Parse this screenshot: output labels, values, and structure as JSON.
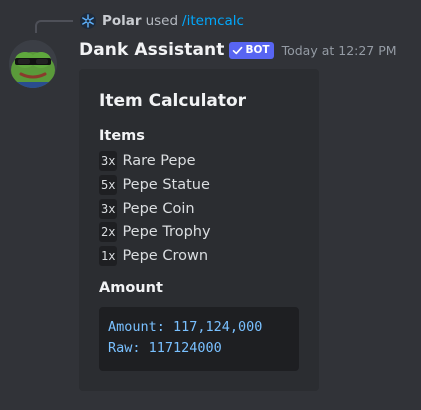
{
  "reply": {
    "username": "Polar",
    "used_text": "used",
    "command": "/itemcalc"
  },
  "message": {
    "username": "Dank Assistant",
    "bot_badge": "BOT",
    "timestamp": "Today at 12:27 PM"
  },
  "embed": {
    "title": "Item Calculator",
    "items_field_name": "Items",
    "items": [
      {
        "qty": "3x",
        "name": "Rare Pepe"
      },
      {
        "qty": "5x",
        "name": "Pepe Statue"
      },
      {
        "qty": "3x",
        "name": "Pepe Coin"
      },
      {
        "qty": "2x",
        "name": "Pepe Trophy"
      },
      {
        "qty": "1x",
        "name": "Pepe Crown"
      }
    ],
    "amount_field_name": "Amount",
    "amount_lines": [
      "Amount: 117,124,000",
      "Raw: 117124000"
    ]
  },
  "colors": {
    "background": "#313338",
    "embed_bg": "#2b2d31",
    "bot_badge": "#5865f2",
    "command_link": "#00a8fc",
    "code_text": "#79c0ff"
  },
  "icons": {
    "reply_avatar": "snowflake-icon",
    "bot_badge": "checkmark-icon",
    "avatar": "pepe-frog-avatar"
  }
}
